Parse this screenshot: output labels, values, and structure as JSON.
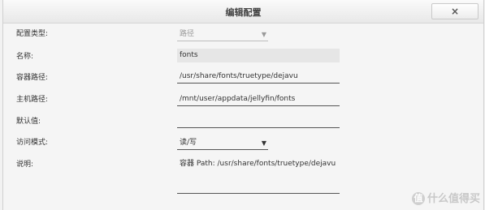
{
  "dialog": {
    "title": "编辑配置",
    "close_label": "×"
  },
  "form": {
    "config_type": {
      "label": "配置类型:",
      "value": "路径"
    },
    "name": {
      "label": "名称:",
      "value": "fonts"
    },
    "container_path": {
      "label": "容器路径:",
      "value": "/usr/share/fonts/truetype/dejavu"
    },
    "host_path": {
      "label": "主机路径:",
      "value": "/mnt/user/appdata/jellyfin/fonts"
    },
    "default_value": {
      "label": "默认值:",
      "value": ""
    },
    "access_mode": {
      "label": "访问模式:",
      "value": "读/写"
    },
    "description": {
      "label": "说明:",
      "value": "容器 Path: /usr/share/fonts/truetype/dejavu"
    }
  },
  "watermark": {
    "text": "什么值得买",
    "logo_char": "值"
  }
}
